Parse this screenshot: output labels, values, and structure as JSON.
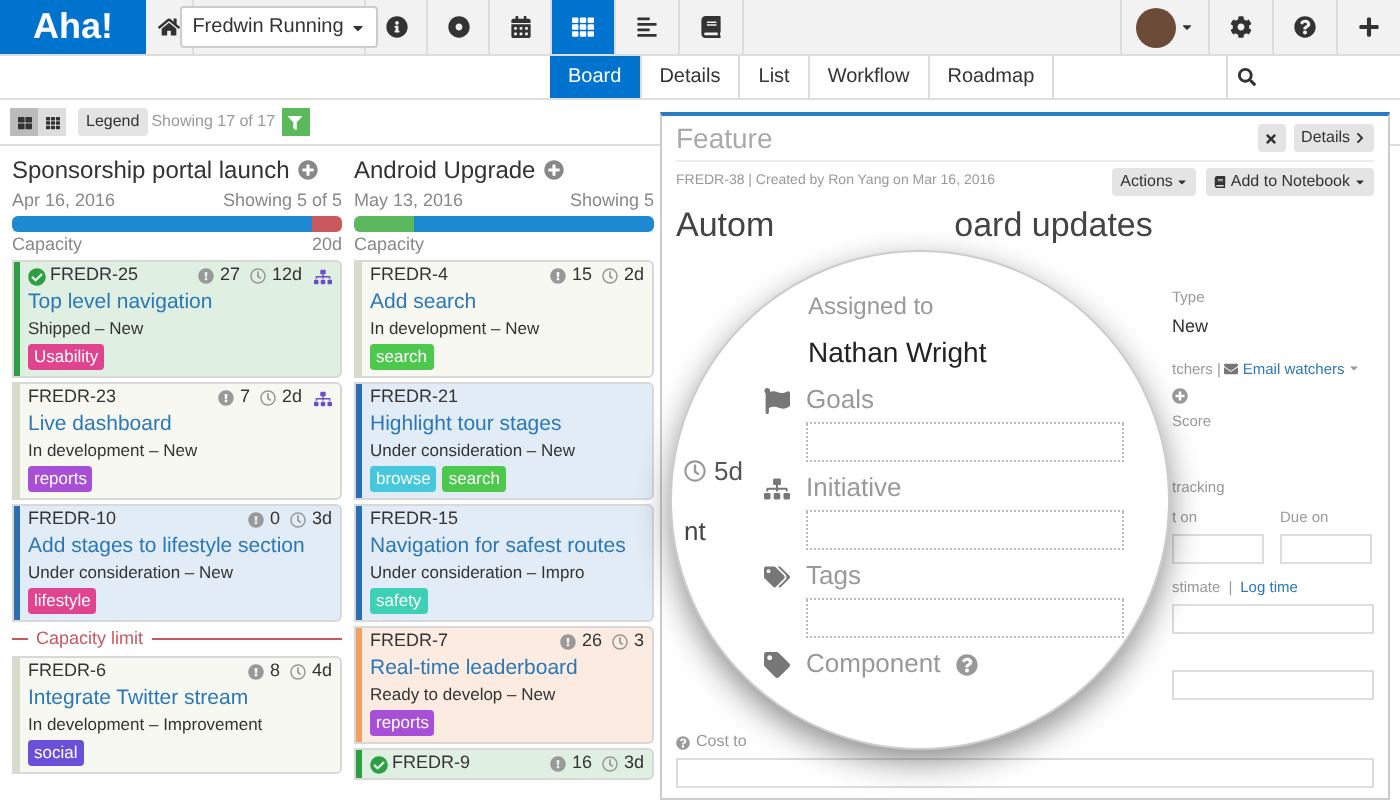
{
  "logo": "Aha!",
  "nav": {
    "workspace": "Fredwin Running",
    "icons": [
      {
        "kind": "info",
        "selected": false
      },
      {
        "kind": "target",
        "selected": false
      },
      {
        "kind": "calendar",
        "selected": false
      },
      {
        "kind": "grid",
        "selected": true
      },
      {
        "kind": "list",
        "selected": false
      },
      {
        "kind": "book",
        "selected": false
      }
    ]
  },
  "tabs": [
    {
      "label": "Board",
      "selected": true
    },
    {
      "label": "Details",
      "selected": false
    },
    {
      "label": "List",
      "selected": false
    },
    {
      "label": "Workflow",
      "selected": false
    },
    {
      "label": "Roadmap",
      "selected": false
    }
  ],
  "toolbar": {
    "views": [
      {
        "kind": "cards",
        "selected": true
      },
      {
        "kind": "grid",
        "selected": false
      }
    ],
    "legend": "Legend",
    "showing": "Showing 17 of 17"
  },
  "columns": [
    {
      "title": "Sponsorship portal launch",
      "date": "Apr 16, 2016",
      "showing": "Showing 5 of 5",
      "capacity_label": "Capacity",
      "capacity_value": "20d",
      "segments": [
        {
          "color": "#1e88d0",
          "level": 0.91
        },
        {
          "color": "#c9585e",
          "level": 0.09
        }
      ],
      "items": [
        {
          "kind": "card",
          "id": "FREDR-25",
          "shipped": true,
          "title": "Top level navigation",
          "status": "Shipped – New",
          "stat_1": "27",
          "stat_2": "12d",
          "initiative": true,
          "color": "#2e9e45",
          "tags": [
            {
              "label": "Usability",
              "color": "#e0448f"
            }
          ]
        },
        {
          "kind": "card",
          "id": "FREDR-23",
          "shipped": false,
          "title": "Live dashboard",
          "status": "In development – New",
          "stat_1": "7",
          "stat_2": "2d",
          "initiative": true,
          "color": "#d7dcc8",
          "tags": [
            {
              "label": "reports",
              "color": "#a74fd6"
            }
          ]
        },
        {
          "kind": "card",
          "id": "FREDR-10",
          "shipped": false,
          "title": "Add stages to lifestyle section",
          "status": "Under consideration – New",
          "stat_1": "0",
          "stat_2": "3d",
          "initiative": false,
          "color": "#2b6fb0",
          "tags": [
            {
              "label": "lifestyle",
              "color": "#e0448f"
            }
          ]
        },
        {
          "kind": "limit",
          "label": "Capacity limit"
        },
        {
          "kind": "card",
          "id": "FREDR-6",
          "shipped": false,
          "title": "Integrate Twitter stream",
          "status": "In development – Improvement",
          "stat_1": "8",
          "stat_2": "4d",
          "initiative": false,
          "color": "#d7dcc8",
          "tags": [
            {
              "label": "social",
              "color": "#6a4fd8"
            }
          ]
        }
      ]
    },
    {
      "title": "Android Upgrade",
      "date": "May 13, 2016",
      "showing": "Showing 5",
      "capacity_label": "Capacity",
      "segments": [
        {
          "color": "#5cb85c",
          "level": 0.2
        },
        {
          "color": "#1e88d0",
          "level": 0.8
        }
      ],
      "items": [
        {
          "kind": "card",
          "id": "FREDR-4",
          "shipped": false,
          "title": "Add search",
          "status": "In development – New",
          "stat_1": "15",
          "stat_2": "2d",
          "initiative": false,
          "color": "#d7dcc8",
          "tags": [
            {
              "label": "search",
              "color": "#4cc94c"
            }
          ]
        },
        {
          "kind": "card",
          "id": "FREDR-21",
          "shipped": false,
          "title": "Highlight tour stages",
          "status": "Under consideration – New",
          "initiative": false,
          "color": "#2b6fb0",
          "tags": [
            {
              "label": "browse",
              "color": "#45c8dc"
            },
            {
              "label": "search",
              "color": "#4cc94c"
            }
          ]
        },
        {
          "kind": "card",
          "id": "FREDR-15",
          "shipped": false,
          "title": "Navigation for safest routes",
          "status": "Under consideration – Impro",
          "initiative": false,
          "color": "#2b6fb0",
          "tags": [
            {
              "label": "safety",
              "color": "#3ed0b4"
            }
          ]
        },
        {
          "kind": "card",
          "id": "FREDR-7",
          "shipped": false,
          "title": "Real-time leaderboard",
          "status": "Ready to develop – New",
          "stat_1": "26",
          "stat_2": "3",
          "initiative": false,
          "color": "#f0a060",
          "tags": [
            {
              "label": "reports",
              "color": "#a74fd6"
            }
          ]
        },
        {
          "kind": "card",
          "id": "FREDR-9",
          "shipped": true,
          "stat_1": "16",
          "stat_2": "3d",
          "initiative": false,
          "color": "#2e9e45"
        }
      ]
    }
  ],
  "panel": {
    "title": "Feature",
    "details": "Details",
    "meta": "FREDR-38 | Created by Ron Yang on Mar 16, 2016",
    "actions": "Actions",
    "notebook": "Add to Notebook",
    "heading_start": "Autom",
    "heading_end": "oard updates",
    "type_label": "Type",
    "type_value": "New",
    "watchers": "tchers",
    "watchers_separator": "|",
    "email_watchers": "Email watchers",
    "score": "Score",
    "tracking": "tracking",
    "start_on": "t on",
    "due_on": "Due on",
    "estimate": "stimate",
    "estimate_separator": "|",
    "log_time": "Log time",
    "cost": "Cost to"
  },
  "magnifier": {
    "assigned_label": "Assigned to",
    "assigned_value": "Nathan Wright",
    "sections": [
      {
        "kind": "goals",
        "label": "Goals",
        "help": false
      },
      {
        "kind": "initiative",
        "label": "Initiative",
        "help": false
      },
      {
        "kind": "tags",
        "label": "Tags",
        "help": false
      },
      {
        "kind": "component",
        "label": "Component",
        "help": true
      }
    ],
    "fragment_time": "5d",
    "fragment_text": "nt"
  }
}
